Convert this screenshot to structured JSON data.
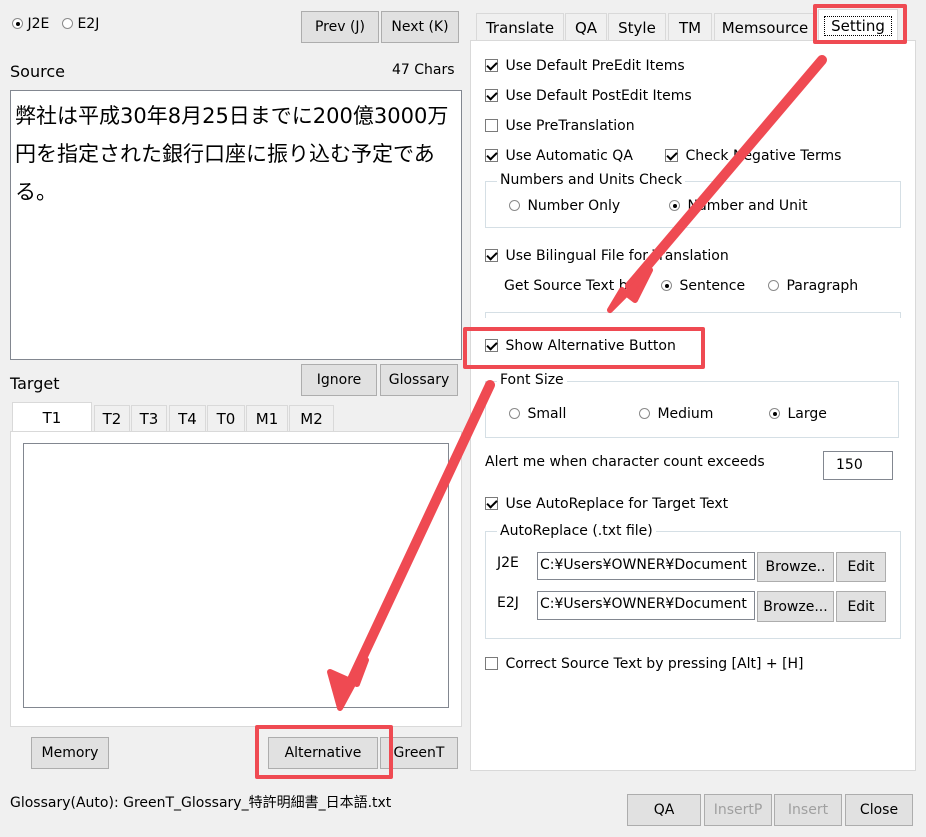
{
  "mode": {
    "j2e": "J2E",
    "e2j": "E2J",
    "selected": "J2E"
  },
  "nav": {
    "prev": "Prev (J)",
    "next": "Next (K)"
  },
  "source": {
    "label": "Source",
    "count": "47 Chars",
    "text": "弊社は平成30年8月25日までに200億3000万円を指定された銀行口座に振り込む予定である。"
  },
  "target": {
    "label": "Target",
    "ignore": "Ignore",
    "glossary": "Glossary",
    "tabs": [
      "T1",
      "T2",
      "T3",
      "T4",
      "T0",
      "M1",
      "M2"
    ]
  },
  "bottom_left": {
    "memory": "Memory",
    "alternative": "Alternative",
    "greent": "GreenT"
  },
  "status": {
    "glossary_text": "Glossary(Auto): GreenT_Glossary_特許明細書_日本語.txt",
    "qa": "QA",
    "insertp": "InsertP",
    "insert": "Insert",
    "close": "Close"
  },
  "right_tabs": [
    "Translate",
    "QA",
    "Style",
    "TM",
    "Memsource",
    "Setting"
  ],
  "setting": {
    "use_default_preedit": "Use Default PreEdit Items",
    "use_default_postedit": "Use Default PostEdit Items",
    "use_pretranslation": "Use PreTranslation",
    "use_automatic_qa": "Use Automatic QA",
    "check_negative_terms": "Check Negative Terms",
    "numbers_units_group": "Numbers and Units Check",
    "number_only": "Number Only",
    "number_and_unit": "Number and Unit",
    "use_bilingual_file": "Use Bilingual File for Translation",
    "get_source_text_by": "Get Source Text by",
    "sentence": "Sentence",
    "paragraph": "Paragraph",
    "show_alternative_button": "Show Alternative Button",
    "font_size_group": "Font Size",
    "small": "Small",
    "medium": "Medium",
    "large": "Large",
    "alert_label": "Alert me when character count exceeds",
    "alert_value": "150",
    "use_autoreplace": "Use AutoReplace for Target Text",
    "autoreplace_group": "AutoReplace (.txt file)",
    "j2e_label": "J2E",
    "j2e_path": "C:¥Users¥OWNER¥Document",
    "e2j_label": "E2J",
    "e2j_path": "C:¥Users¥OWNER¥Document",
    "browse1": "Browze..",
    "browse2": "Browze...",
    "edit": "Edit",
    "correct_source": "Correct Source Text by pressing [Alt] + [H]"
  },
  "colors": {
    "annotation": "#ef4a52"
  }
}
